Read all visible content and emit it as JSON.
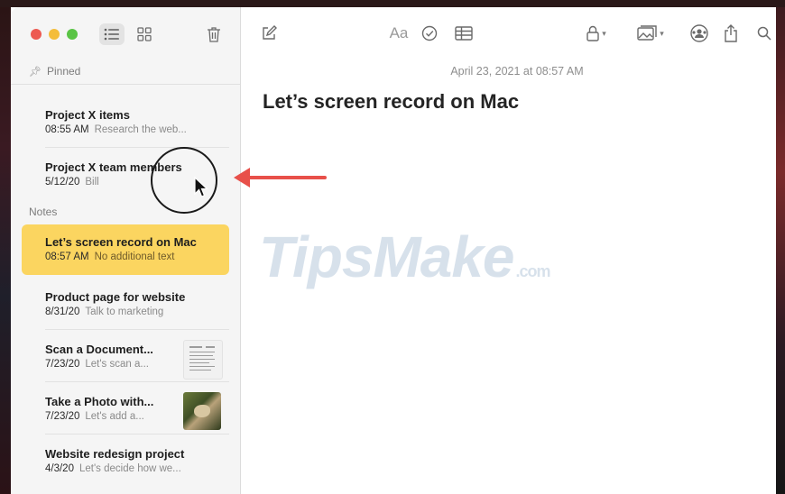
{
  "sidebar": {
    "pinned_label": "Pinned",
    "notes_label": "Notes",
    "pinned": [
      {
        "title": "Project X items",
        "date": "08:55 AM",
        "preview": "Research the web..."
      },
      {
        "title": "Project X team members",
        "date": "5/12/20",
        "preview": "Bill"
      }
    ],
    "notes": [
      {
        "title": "Let’s screen record on Mac",
        "date": "08:57 AM",
        "preview": "No additional text"
      },
      {
        "title": "Product page for website",
        "date": "8/31/20",
        "preview": "Talk to marketing"
      },
      {
        "title": "Scan a Document...",
        "date": "7/23/20",
        "preview": "Let's scan a..."
      },
      {
        "title": "Take a Photo with...",
        "date": "7/23/20",
        "preview": "Let's add a..."
      },
      {
        "title": "Website redesign project",
        "date": "4/3/20",
        "preview": "Let's decide how we..."
      }
    ]
  },
  "toolbar": {
    "format_label": "Aa"
  },
  "editor": {
    "date": "April 23, 2021 at 08:57 AM",
    "heading": "Let’s screen record on Mac"
  },
  "watermark": {
    "main": "TipsMake",
    "suffix": ".com"
  },
  "colors": {
    "selected_note": "#fbd560",
    "annotation_arrow": "#e8504a"
  }
}
